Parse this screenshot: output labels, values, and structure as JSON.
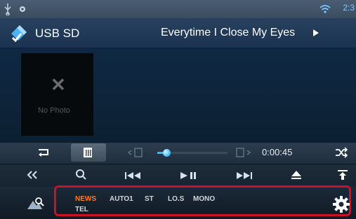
{
  "status_bar": {
    "icons": [
      "usb-icon",
      "gear-small-icon",
      "wifi-icon"
    ],
    "clock": "2:3"
  },
  "header": {
    "source_icon": "usb-sd-icon",
    "source_label": "USB SD",
    "track_title": "Everytime I Close My Eyes",
    "title_more_icon": "play-arrow-icon"
  },
  "album_art": {
    "placeholder_icon": "x-icon",
    "placeholder_label": "No Photo"
  },
  "transport": {
    "progress_fraction": 0.14,
    "elapsed_time": "0:00:45"
  },
  "controls": {
    "icons": [
      "back-icon",
      "search-icon",
      "previous-icon",
      "play-pause-icon",
      "next-icon",
      "eject-icon",
      "tilt-icon"
    ]
  },
  "bottom": {
    "flags": [
      {
        "label": "NEWS",
        "active": true
      },
      {
        "label": "AUTO1",
        "active": false
      },
      {
        "label": "ST",
        "active": false
      },
      {
        "label": "LO.S",
        "active": false
      },
      {
        "label": "MONO",
        "active": false
      },
      {
        "label": "TEL",
        "active": false
      }
    ]
  },
  "colors": {
    "accent": "#37b7ff",
    "highlight": "#c8112a",
    "active_flag": "#ff7a1e"
  }
}
